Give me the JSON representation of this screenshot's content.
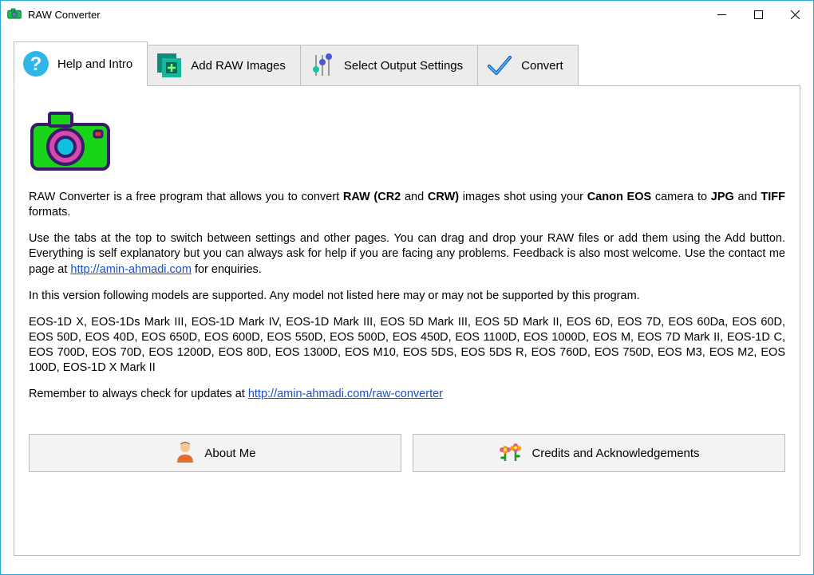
{
  "window": {
    "title": "RAW Converter"
  },
  "tabs": {
    "help": {
      "label": "Help and Intro"
    },
    "add": {
      "label": "Add RAW Images"
    },
    "output": {
      "label": "Select Output Settings"
    },
    "convert": {
      "label": "Convert"
    }
  },
  "intro": {
    "p1_pre": "RAW Converter is a free program that allows you to convert ",
    "p1_b1": "RAW (CR2",
    "p1_mid1": " and ",
    "p1_b2": "CRW)",
    "p1_mid2": " images shot using your ",
    "p1_b3": "Canon EOS",
    "p1_mid3": " camera to ",
    "p1_b4": "JPG",
    "p1_mid4": " and ",
    "p1_b5": "TIFF",
    "p1_post": " formats.",
    "p2_pre": "Use the tabs at the top to switch between settings and other pages. You can drag and drop your RAW files or add them using the Add button. Everything is self explanatory but you can always ask for help if you are facing any problems. Feedback is also most welcome. Use the contact me page at ",
    "p2_link": "http://amin-ahmadi.com",
    "p2_post": " for enquiries.",
    "p3": "In this version following models are supported. Any model not listed here may or may not be supported by this program.",
    "p4": "EOS-1D X, EOS-1Ds Mark III, EOS-1D Mark IV, EOS-1D Mark III, EOS 5D Mark III, EOS 5D Mark II, EOS 6D, EOS 7D, EOS 60Da, EOS 60D, EOS 50D, EOS 40D, EOS 650D, EOS 600D, EOS 550D, EOS 500D, EOS 450D, EOS 1100D, EOS 1000D, EOS M, EOS 7D Mark II, EOS-1D C, EOS 700D, EOS 70D, EOS 1200D, EOS 80D, EOS 1300D, EOS M10, EOS 5DS, EOS 5DS R, EOS 760D, EOS 750D, EOS M3, EOS M2, EOS 100D, EOS-1D X Mark II",
    "p5_pre": "Remember to always check for updates at ",
    "p5_link": "http://amin-ahmadi.com/raw-converter"
  },
  "buttons": {
    "aboutMe": "About Me",
    "credits": "Credits and Acknowledgements"
  }
}
